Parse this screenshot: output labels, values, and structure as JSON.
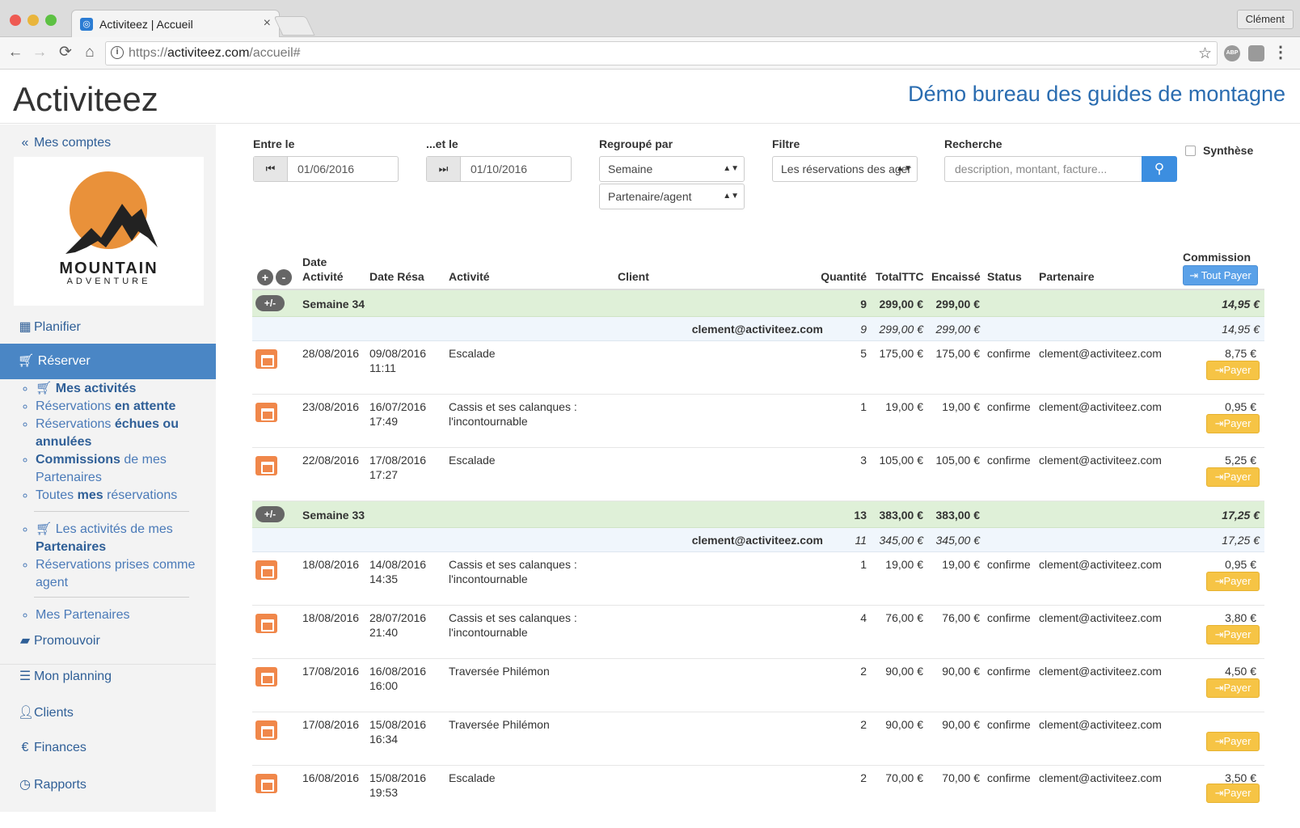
{
  "browser": {
    "tab_title": "Activiteez | Accueil",
    "profile_name": "Clément",
    "url_scheme": "https://",
    "url_domain": "activiteez.com",
    "url_path": "/accueil#",
    "ext1_label": "ABP"
  },
  "header": {
    "brand": "Activiteez",
    "organization": "Démo bureau des guides de montagne"
  },
  "sidebar": {
    "accounts_link": "Mes comptes",
    "logo_word1": "MOUNTAIN",
    "logo_word2": "ADVENTURE",
    "plan": "Planifier",
    "reserve": "Réserver",
    "sub": {
      "item1_bold": "Mes activités",
      "item2_a": "Réservations ",
      "item2_b": "en attente",
      "item3_a": "Réservations ",
      "item3_b": "échues ou annulées",
      "item4_a": "Commissions",
      "item4_b": " de mes Partenaires",
      "item5_a": "Toutes ",
      "item5_b": "mes",
      "item5_c": " réservations",
      "item6_a": "Les activités de mes ",
      "item6_b": "Partenaires",
      "item7": "Réservations prises comme agent",
      "item8": "Mes Partenaires"
    },
    "promote": "Promouvoir",
    "planning": "Mon planning",
    "clients": "Clients",
    "finances": "Finances",
    "reports": "Rapports"
  },
  "filters": {
    "from_label": "Entre le",
    "from_value": "01/06/2016",
    "to_label": "...et le",
    "to_value": "01/10/2016",
    "group_label": "Regroupé par",
    "group_value1": "Semaine",
    "group_value2": "Partenaire/agent",
    "filter_label": "Filtre",
    "filter_value": "Les réservations des ager",
    "search_label": "Recherche",
    "search_placeholder": "description, montant, facture...",
    "synthese_label": "Synthèse"
  },
  "table": {
    "headers": {
      "date_activite_1": "Date",
      "date_activite_2": "Activité",
      "date_resa": "Date Résa",
      "activite": "Activité",
      "client": "Client",
      "quantite": "Quantité",
      "total": "TotalTTC",
      "encaisse": "Encaissé",
      "status": "Status",
      "partenaire": "Partenaire",
      "commission": "Commission",
      "tout_payer": "Tout Payer"
    },
    "plus": "+",
    "minus": "-",
    "pm": "+/-",
    "pay_label": "Payer",
    "weeks": [
      {
        "label": "Semaine 34",
        "qty": "9",
        "total": "299,00 €",
        "encaisse": "299,00 €",
        "commission": "14,95 €",
        "sum_client": "clement@activiteez.com",
        "sum_qty": "9",
        "sum_total": "299,00 €",
        "sum_encaisse": "299,00 €",
        "sum_commission": "14,95 €"
      },
      {
        "label": "Semaine 33",
        "qty": "13",
        "total": "383,00 €",
        "encaisse": "383,00 €",
        "commission": "17,25 €",
        "sum_client": "clement@activiteez.com",
        "sum_qty": "11",
        "sum_total": "345,00 €",
        "sum_encaisse": "345,00 €",
        "sum_commission": "17,25 €"
      }
    ],
    "rows": [
      {
        "date": "28/08/2016",
        "resa_date": "09/08/2016",
        "resa_time": "11:11",
        "activite1": "Escalade",
        "activite2": "",
        "qty": "5",
        "total": "175,00 €",
        "encaisse": "175,00 €",
        "status": "confirme",
        "partenaire": "clement@activiteez.com",
        "commission": "8,75 €"
      },
      {
        "date": "23/08/2016",
        "resa_date": "16/07/2016",
        "resa_time": "17:49",
        "activite1": "Cassis et ses calanques :",
        "activite2": "l'incontournable",
        "qty": "1",
        "total": "19,00 €",
        "encaisse": "19,00 €",
        "status": "confirme",
        "partenaire": "clement@activiteez.com",
        "commission": "0,95 €"
      },
      {
        "date": "22/08/2016",
        "resa_date": "17/08/2016",
        "resa_time": "17:27",
        "activite1": "Escalade",
        "activite2": "",
        "qty": "3",
        "total": "105,00 €",
        "encaisse": "105,00 €",
        "status": "confirme",
        "partenaire": "clement@activiteez.com",
        "commission": "5,25 €"
      },
      {
        "date": "18/08/2016",
        "resa_date": "14/08/2016",
        "resa_time": "14:35",
        "activite1": "Cassis et ses calanques :",
        "activite2": "l'incontournable",
        "qty": "1",
        "total": "19,00 €",
        "encaisse": "19,00 €",
        "status": "confirme",
        "partenaire": "clement@activiteez.com",
        "commission": "0,95 €"
      },
      {
        "date": "18/08/2016",
        "resa_date": "28/07/2016",
        "resa_time": "21:40",
        "activite1": "Cassis et ses calanques :",
        "activite2": "l'incontournable",
        "qty": "4",
        "total": "76,00 €",
        "encaisse": "76,00 €",
        "status": "confirme",
        "partenaire": "clement@activiteez.com",
        "commission": "3,80 €"
      },
      {
        "date": "17/08/2016",
        "resa_date": "16/08/2016",
        "resa_time": "16:00",
        "activite1": "Traversée Philémon",
        "activite2": "",
        "qty": "2",
        "total": "90,00 €",
        "encaisse": "90,00 €",
        "status": "confirme",
        "partenaire": "clement@activiteez.com",
        "commission": "4,50 €"
      },
      {
        "date": "17/08/2016",
        "resa_date": "15/08/2016",
        "resa_time": "16:34",
        "activite1": "Traversée Philémon",
        "activite2": "",
        "qty": "2",
        "total": "90,00 €",
        "encaisse": "90,00 €",
        "status": "confirme",
        "partenaire": "clement@activiteez.com",
        "commission": ""
      },
      {
        "date": "16/08/2016",
        "resa_date": "15/08/2016",
        "resa_time": "19:53",
        "activite1": "Escalade",
        "activite2": "",
        "qty": "2",
        "total": "70,00 €",
        "encaisse": "70,00 €",
        "status": "confirme",
        "partenaire": "clement@activiteez.com",
        "commission": "3,50 €"
      }
    ]
  }
}
